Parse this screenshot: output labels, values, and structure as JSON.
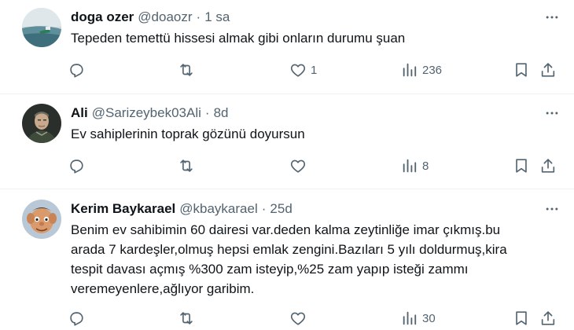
{
  "tweets": [
    {
      "name": "doga ozer",
      "handle": "@doaozr",
      "separator": "·",
      "time": "1 sa",
      "text": "Tepeden temettü hissesi almak gibi onların durumu şuan",
      "replies": "",
      "retweets": "",
      "likes": "1",
      "views": "236"
    },
    {
      "name": "Ali",
      "handle": "@Sarizeybek03Ali",
      "separator": "·",
      "time": "8d",
      "text": "Ev sahiplerinin toprak gözünü doyursun",
      "replies": "",
      "retweets": "",
      "likes": "",
      "views": "8"
    },
    {
      "name": "Kerim Baykarael",
      "handle": "@kbaykarael",
      "separator": "·",
      "time": "25d",
      "text_lines": [
        "Benim ev sahibimin 60 dairesi var.deden kalma zeytinliğe imar çıkmış.bu",
        "arada 7 kardeşler,olmuş hepsi emlak zengini.Bazıları 5 yılı doldurmuş,kira",
        "tespit davası açmış %300 zam isteyip,%25 zam yapıp isteği zammı",
        "veremeyenlere,ağlıyor garibim."
      ],
      "replies": "",
      "retweets": "",
      "likes": "",
      "views": "30"
    }
  ],
  "icons": {
    "reply": "reply-icon",
    "retweet": "retweet-icon",
    "like": "heart-icon",
    "views": "views-icon",
    "bookmark": "bookmark-icon",
    "share": "share-icon",
    "more": "more-icon"
  },
  "colors": {
    "text": "#0f1419",
    "secondary": "#536471",
    "divider": "#eff3f4"
  }
}
